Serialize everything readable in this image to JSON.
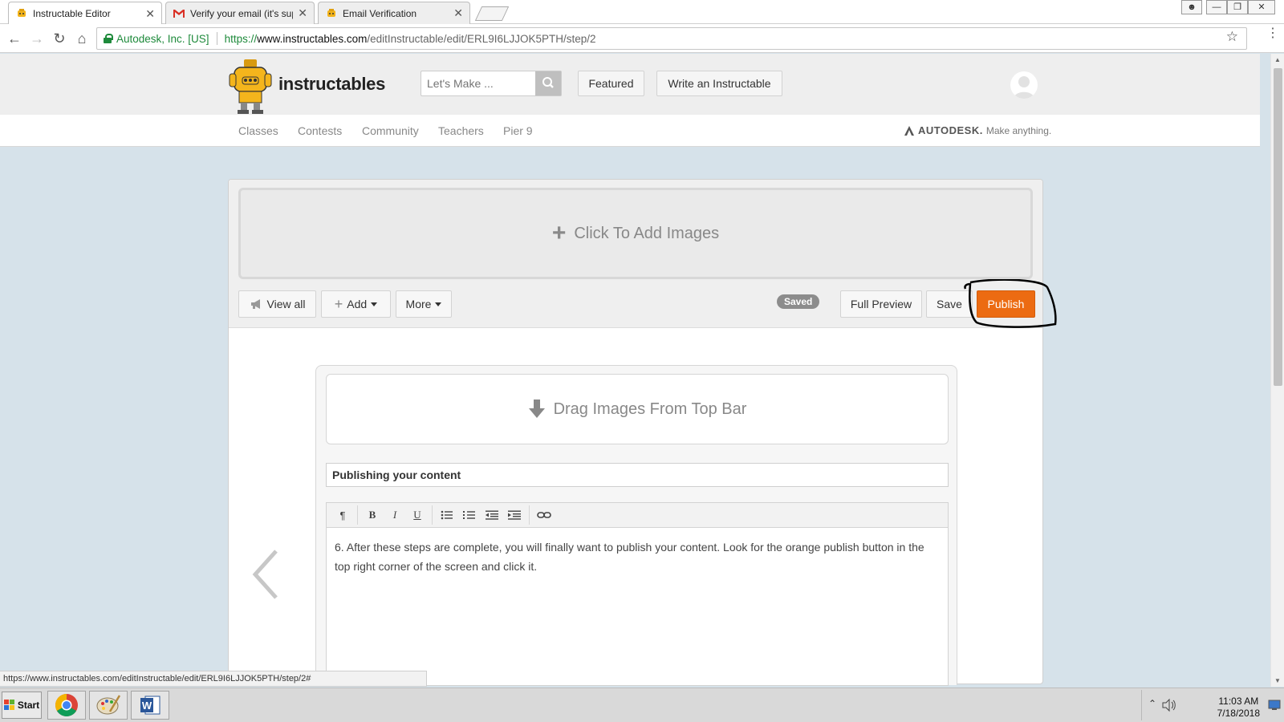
{
  "browser": {
    "tabs": [
      {
        "label": "Instructable Editor",
        "active": true
      },
      {
        "label": "Verify your email (it's sup",
        "active": false
      },
      {
        "label": "Email Verification",
        "active": false
      }
    ],
    "address": {
      "secure_org": "Autodesk, Inc. [US]",
      "scheme": "https://",
      "host": "www.instructables.com",
      "path": "/editInstructable/edit/ERL9I6LJJOK5PTH/step/2"
    },
    "status_url": "https://www.instructables.com/editInstructable/edit/ERL9I6LJJOK5PTH/step/2#"
  },
  "site": {
    "logo_text": "instructables",
    "search_placeholder": "Let's Make ...",
    "header_buttons": {
      "featured": "Featured",
      "write": "Write an Instructable"
    },
    "subnav": [
      "Classes",
      "Contests",
      "Community",
      "Teachers",
      "Pier 9"
    ],
    "autodesk": {
      "brand": "AUTODESK.",
      "tagline": "Make anything."
    }
  },
  "editor": {
    "add_images": "Click To Add Images",
    "toolbar": {
      "view_all": "View all",
      "add": "Add",
      "more": "More",
      "saved": "Saved",
      "full_preview": "Full Preview",
      "save": "Save",
      "publish": "Publish"
    },
    "step": {
      "drag_images": "Drag Images From Top Bar",
      "title": "Publishing your content",
      "body": "6. After these steps are complete, you will finally want to publish your content. Look for the orange publish button in the top right corner of the screen and click it."
    }
  },
  "taskbar": {
    "start": "Start",
    "time": "11:03 AM",
    "date": "7/18/2018"
  },
  "colors": {
    "publish": "#ec6b12",
    "page_bg": "#d6e2ea",
    "secure_green": "#1e8a3b"
  }
}
